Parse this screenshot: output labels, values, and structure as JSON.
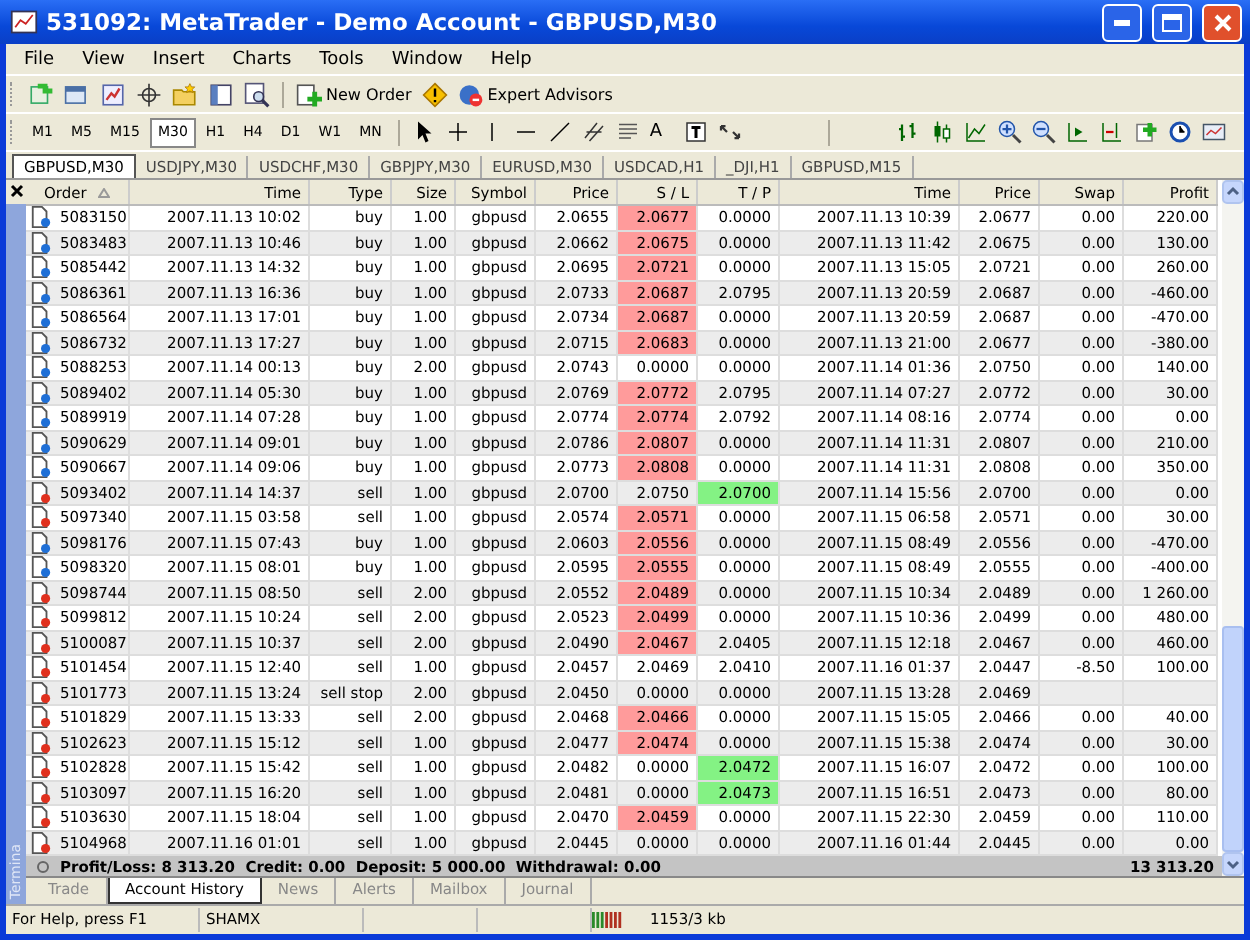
{
  "window": {
    "title": "531092: MetaTrader - Demo Account - GBPUSD,M30"
  },
  "menu": [
    "File",
    "View",
    "Insert",
    "Charts",
    "Tools",
    "Window",
    "Help"
  ],
  "toolbar": {
    "new_order": "New Order",
    "expert_advisors": "Expert Advisors",
    "text_tool": "A",
    "timeframes": [
      {
        "label": "M1",
        "selected": false
      },
      {
        "label": "M5",
        "selected": false
      },
      {
        "label": "M15",
        "selected": false
      },
      {
        "label": "M30",
        "selected": true
      },
      {
        "label": "H1",
        "selected": false
      },
      {
        "label": "H4",
        "selected": false
      },
      {
        "label": "D1",
        "selected": false
      },
      {
        "label": "W1",
        "selected": false
      },
      {
        "label": "MN",
        "selected": false
      }
    ]
  },
  "chart_tabs": [
    {
      "label": "GBPUSD,M30",
      "selected": true
    },
    {
      "label": "USDJPY,M30",
      "selected": false
    },
    {
      "label": "USDCHF,M30",
      "selected": false
    },
    {
      "label": "GBPJPY,M30",
      "selected": false
    },
    {
      "label": "EURUSD,M30",
      "selected": false
    },
    {
      "label": "USDCAD,H1",
      "selected": false
    },
    {
      "label": "_DJI,H1",
      "selected": false
    },
    {
      "label": "GBPUSD,M15",
      "selected": false
    }
  ],
  "terminal": {
    "side_label": "Termina",
    "columns": [
      "Order",
      "Time",
      "Type",
      "Size",
      "Symbol",
      "Price",
      "S / L",
      "T / P",
      "Time",
      "Price",
      "Swap",
      "Profit"
    ],
    "rows": [
      {
        "kind": "buy",
        "order": "5083150",
        "open_time": "2007.11.13 10:02",
        "type": "buy",
        "size": "1.00",
        "symbol": "gbpusd",
        "open_price": "2.0655",
        "sl": "2.0677",
        "sl_hit": true,
        "tp": "0.0000",
        "tp_hit": false,
        "close_time": "2007.11.13 10:39",
        "close_price": "2.0677",
        "swap": "0.00",
        "profit": "220.00"
      },
      {
        "kind": "buy",
        "order": "5083483",
        "open_time": "2007.11.13 10:46",
        "type": "buy",
        "size": "1.00",
        "symbol": "gbpusd",
        "open_price": "2.0662",
        "sl": "2.0675",
        "sl_hit": true,
        "tp": "0.0000",
        "tp_hit": false,
        "close_time": "2007.11.13 11:42",
        "close_price": "2.0675",
        "swap": "0.00",
        "profit": "130.00"
      },
      {
        "kind": "buy",
        "order": "5085442",
        "open_time": "2007.11.13 14:32",
        "type": "buy",
        "size": "1.00",
        "symbol": "gbpusd",
        "open_price": "2.0695",
        "sl": "2.0721",
        "sl_hit": true,
        "tp": "0.0000",
        "tp_hit": false,
        "close_time": "2007.11.13 15:05",
        "close_price": "2.0721",
        "swap": "0.00",
        "profit": "260.00"
      },
      {
        "kind": "buy",
        "order": "5086361",
        "open_time": "2007.11.13 16:36",
        "type": "buy",
        "size": "1.00",
        "symbol": "gbpusd",
        "open_price": "2.0733",
        "sl": "2.0687",
        "sl_hit": true,
        "tp": "2.0795",
        "tp_hit": false,
        "close_time": "2007.11.13 20:59",
        "close_price": "2.0687",
        "swap": "0.00",
        "profit": "-460.00"
      },
      {
        "kind": "buy",
        "order": "5086564",
        "open_time": "2007.11.13 17:01",
        "type": "buy",
        "size": "1.00",
        "symbol": "gbpusd",
        "open_price": "2.0734",
        "sl": "2.0687",
        "sl_hit": true,
        "tp": "0.0000",
        "tp_hit": false,
        "close_time": "2007.11.13 20:59",
        "close_price": "2.0687",
        "swap": "0.00",
        "profit": "-470.00"
      },
      {
        "kind": "buy",
        "order": "5086732",
        "open_time": "2007.11.13 17:27",
        "type": "buy",
        "size": "1.00",
        "symbol": "gbpusd",
        "open_price": "2.0715",
        "sl": "2.0683",
        "sl_hit": true,
        "tp": "0.0000",
        "tp_hit": false,
        "close_time": "2007.11.13 21:00",
        "close_price": "2.0677",
        "swap": "0.00",
        "profit": "-380.00"
      },
      {
        "kind": "buy",
        "order": "5088253",
        "open_time": "2007.11.14 00:13",
        "type": "buy",
        "size": "2.00",
        "symbol": "gbpusd",
        "open_price": "2.0743",
        "sl": "0.0000",
        "sl_hit": false,
        "tp": "0.0000",
        "tp_hit": false,
        "close_time": "2007.11.14 01:36",
        "close_price": "2.0750",
        "swap": "0.00",
        "profit": "140.00"
      },
      {
        "kind": "buy",
        "order": "5089402",
        "open_time": "2007.11.14 05:30",
        "type": "buy",
        "size": "1.00",
        "symbol": "gbpusd",
        "open_price": "2.0769",
        "sl": "2.0772",
        "sl_hit": true,
        "tp": "2.0795",
        "tp_hit": false,
        "close_time": "2007.11.14 07:27",
        "close_price": "2.0772",
        "swap": "0.00",
        "profit": "30.00"
      },
      {
        "kind": "buy",
        "order": "5089919",
        "open_time": "2007.11.14 07:28",
        "type": "buy",
        "size": "1.00",
        "symbol": "gbpusd",
        "open_price": "2.0774",
        "sl": "2.0774",
        "sl_hit": true,
        "tp": "2.0792",
        "tp_hit": false,
        "close_time": "2007.11.14 08:16",
        "close_price": "2.0774",
        "swap": "0.00",
        "profit": "0.00"
      },
      {
        "kind": "buy",
        "order": "5090629",
        "open_time": "2007.11.14 09:01",
        "type": "buy",
        "size": "1.00",
        "symbol": "gbpusd",
        "open_price": "2.0786",
        "sl": "2.0807",
        "sl_hit": true,
        "tp": "0.0000",
        "tp_hit": false,
        "close_time": "2007.11.14 11:31",
        "close_price": "2.0807",
        "swap": "0.00",
        "profit": "210.00"
      },
      {
        "kind": "buy",
        "order": "5090667",
        "open_time": "2007.11.14 09:06",
        "type": "buy",
        "size": "1.00",
        "symbol": "gbpusd",
        "open_price": "2.0773",
        "sl": "2.0808",
        "sl_hit": true,
        "tp": "0.0000",
        "tp_hit": false,
        "close_time": "2007.11.14 11:31",
        "close_price": "2.0808",
        "swap": "0.00",
        "profit": "350.00"
      },
      {
        "kind": "sell",
        "order": "5093402",
        "open_time": "2007.11.14 14:37",
        "type": "sell",
        "size": "1.00",
        "symbol": "gbpusd",
        "open_price": "2.0700",
        "sl": "2.0750",
        "sl_hit": false,
        "tp": "2.0700",
        "tp_hit": true,
        "close_time": "2007.11.14 15:56",
        "close_price": "2.0700",
        "swap": "0.00",
        "profit": "0.00"
      },
      {
        "kind": "sell",
        "order": "5097340",
        "open_time": "2007.11.15 03:58",
        "type": "sell",
        "size": "1.00",
        "symbol": "gbpusd",
        "open_price": "2.0574",
        "sl": "2.0571",
        "sl_hit": true,
        "tp": "0.0000",
        "tp_hit": false,
        "close_time": "2007.11.15 06:58",
        "close_price": "2.0571",
        "swap": "0.00",
        "profit": "30.00"
      },
      {
        "kind": "buy",
        "order": "5098176",
        "open_time": "2007.11.15 07:43",
        "type": "buy",
        "size": "1.00",
        "symbol": "gbpusd",
        "open_price": "2.0603",
        "sl": "2.0556",
        "sl_hit": true,
        "tp": "0.0000",
        "tp_hit": false,
        "close_time": "2007.11.15 08:49",
        "close_price": "2.0556",
        "swap": "0.00",
        "profit": "-470.00"
      },
      {
        "kind": "buy",
        "order": "5098320",
        "open_time": "2007.11.15 08:01",
        "type": "buy",
        "size": "1.00",
        "symbol": "gbpusd",
        "open_price": "2.0595",
        "sl": "2.0555",
        "sl_hit": true,
        "tp": "0.0000",
        "tp_hit": false,
        "close_time": "2007.11.15 08:49",
        "close_price": "2.0555",
        "swap": "0.00",
        "profit": "-400.00"
      },
      {
        "kind": "sell",
        "order": "5098744",
        "open_time": "2007.11.15 08:50",
        "type": "sell",
        "size": "2.00",
        "symbol": "gbpusd",
        "open_price": "2.0552",
        "sl": "2.0489",
        "sl_hit": true,
        "tp": "0.0000",
        "tp_hit": false,
        "close_time": "2007.11.15 10:34",
        "close_price": "2.0489",
        "swap": "0.00",
        "profit": "1 260.00"
      },
      {
        "kind": "sell",
        "order": "5099812",
        "open_time": "2007.11.15 10:24",
        "type": "sell",
        "size": "2.00",
        "symbol": "gbpusd",
        "open_price": "2.0523",
        "sl": "2.0499",
        "sl_hit": true,
        "tp": "0.0000",
        "tp_hit": false,
        "close_time": "2007.11.15 10:36",
        "close_price": "2.0499",
        "swap": "0.00",
        "profit": "480.00"
      },
      {
        "kind": "sell",
        "order": "5100087",
        "open_time": "2007.11.15 10:37",
        "type": "sell",
        "size": "2.00",
        "symbol": "gbpusd",
        "open_price": "2.0490",
        "sl": "2.0467",
        "sl_hit": true,
        "tp": "2.0405",
        "tp_hit": false,
        "close_time": "2007.11.15 12:18",
        "close_price": "2.0467",
        "swap": "0.00",
        "profit": "460.00"
      },
      {
        "kind": "sell",
        "order": "5101454",
        "open_time": "2007.11.15 12:40",
        "type": "sell",
        "size": "1.00",
        "symbol": "gbpusd",
        "open_price": "2.0457",
        "sl": "2.0469",
        "sl_hit": false,
        "tp": "2.0410",
        "tp_hit": false,
        "close_time": "2007.11.16 01:37",
        "close_price": "2.0447",
        "swap": "-8.50",
        "profit": "100.00"
      },
      {
        "kind": "sell",
        "order": "5101773",
        "open_time": "2007.11.15 13:24",
        "type": "sell stop",
        "size": "2.00",
        "symbol": "gbpusd",
        "open_price": "2.0450",
        "sl": "0.0000",
        "sl_hit": false,
        "tp": "0.0000",
        "tp_hit": false,
        "close_time": "2007.11.15 13:28",
        "close_price": "2.0469"
      },
      {
        "kind": "sell",
        "order": "5101829",
        "open_time": "2007.11.15 13:33",
        "type": "sell",
        "size": "2.00",
        "symbol": "gbpusd",
        "open_price": "2.0468",
        "sl": "2.0466",
        "sl_hit": true,
        "tp": "0.0000",
        "tp_hit": false,
        "close_time": "2007.11.15 15:05",
        "close_price": "2.0466",
        "swap": "0.00",
        "profit": "40.00"
      },
      {
        "kind": "sell",
        "order": "5102623",
        "open_time": "2007.11.15 15:12",
        "type": "sell",
        "size": "1.00",
        "symbol": "gbpusd",
        "open_price": "2.0477",
        "sl": "2.0474",
        "sl_hit": true,
        "tp": "0.0000",
        "tp_hit": false,
        "close_time": "2007.11.15 15:38",
        "close_price": "2.0474",
        "swap": "0.00",
        "profit": "30.00"
      },
      {
        "kind": "sell",
        "order": "5102828",
        "open_time": "2007.11.15 15:42",
        "type": "sell",
        "size": "1.00",
        "symbol": "gbpusd",
        "open_price": "2.0482",
        "sl": "0.0000",
        "sl_hit": false,
        "tp": "2.0472",
        "tp_hit": true,
        "close_time": "2007.11.15 16:07",
        "close_price": "2.0472",
        "swap": "0.00",
        "profit": "100.00"
      },
      {
        "kind": "sell",
        "order": "5103097",
        "open_time": "2007.11.15 16:20",
        "type": "sell",
        "size": "1.00",
        "symbol": "gbpusd",
        "open_price": "2.0481",
        "sl": "0.0000",
        "sl_hit": false,
        "tp": "2.0473",
        "tp_hit": true,
        "close_time": "2007.11.15 16:51",
        "close_price": "2.0473",
        "swap": "0.00",
        "profit": "80.00"
      },
      {
        "kind": "sell",
        "order": "5103630",
        "open_time": "2007.11.15 18:04",
        "type": "sell",
        "size": "1.00",
        "symbol": "gbpusd",
        "open_price": "2.0470",
        "sl": "2.0459",
        "sl_hit": true,
        "tp": "0.0000",
        "tp_hit": false,
        "close_time": "2007.11.15 22:30",
        "close_price": "2.0459",
        "swap": "0.00",
        "profit": "110.00"
      },
      {
        "kind": "sell",
        "order": "5104968",
        "open_time": "2007.11.16 01:01",
        "type": "sell",
        "size": "1.00",
        "symbol": "gbpusd",
        "open_price": "2.0445",
        "sl": "0.0000",
        "sl_hit": false,
        "tp": "0.0000",
        "tp_hit": false,
        "close_time": "2007.11.16 01:44",
        "close_price": "2.0445",
        "swap": "0.00",
        "profit": "0.00"
      }
    ],
    "summary": {
      "text": "Profit/Loss: 8 313.20  Credit: 0.00  Deposit: 5 000.00  Withdrawal: 0.00",
      "total": "13 313.20"
    },
    "tabs": [
      {
        "label": "Trade",
        "selected": false
      },
      {
        "label": "Account History",
        "selected": true
      },
      {
        "label": "News",
        "selected": false
      },
      {
        "label": "Alerts",
        "selected": false
      },
      {
        "label": "Mailbox",
        "selected": false
      },
      {
        "label": "Journal",
        "selected": false
      }
    ]
  },
  "status_bar": [
    "For Help, press F1",
    "SHAMX",
    "1153/3 kb"
  ]
}
